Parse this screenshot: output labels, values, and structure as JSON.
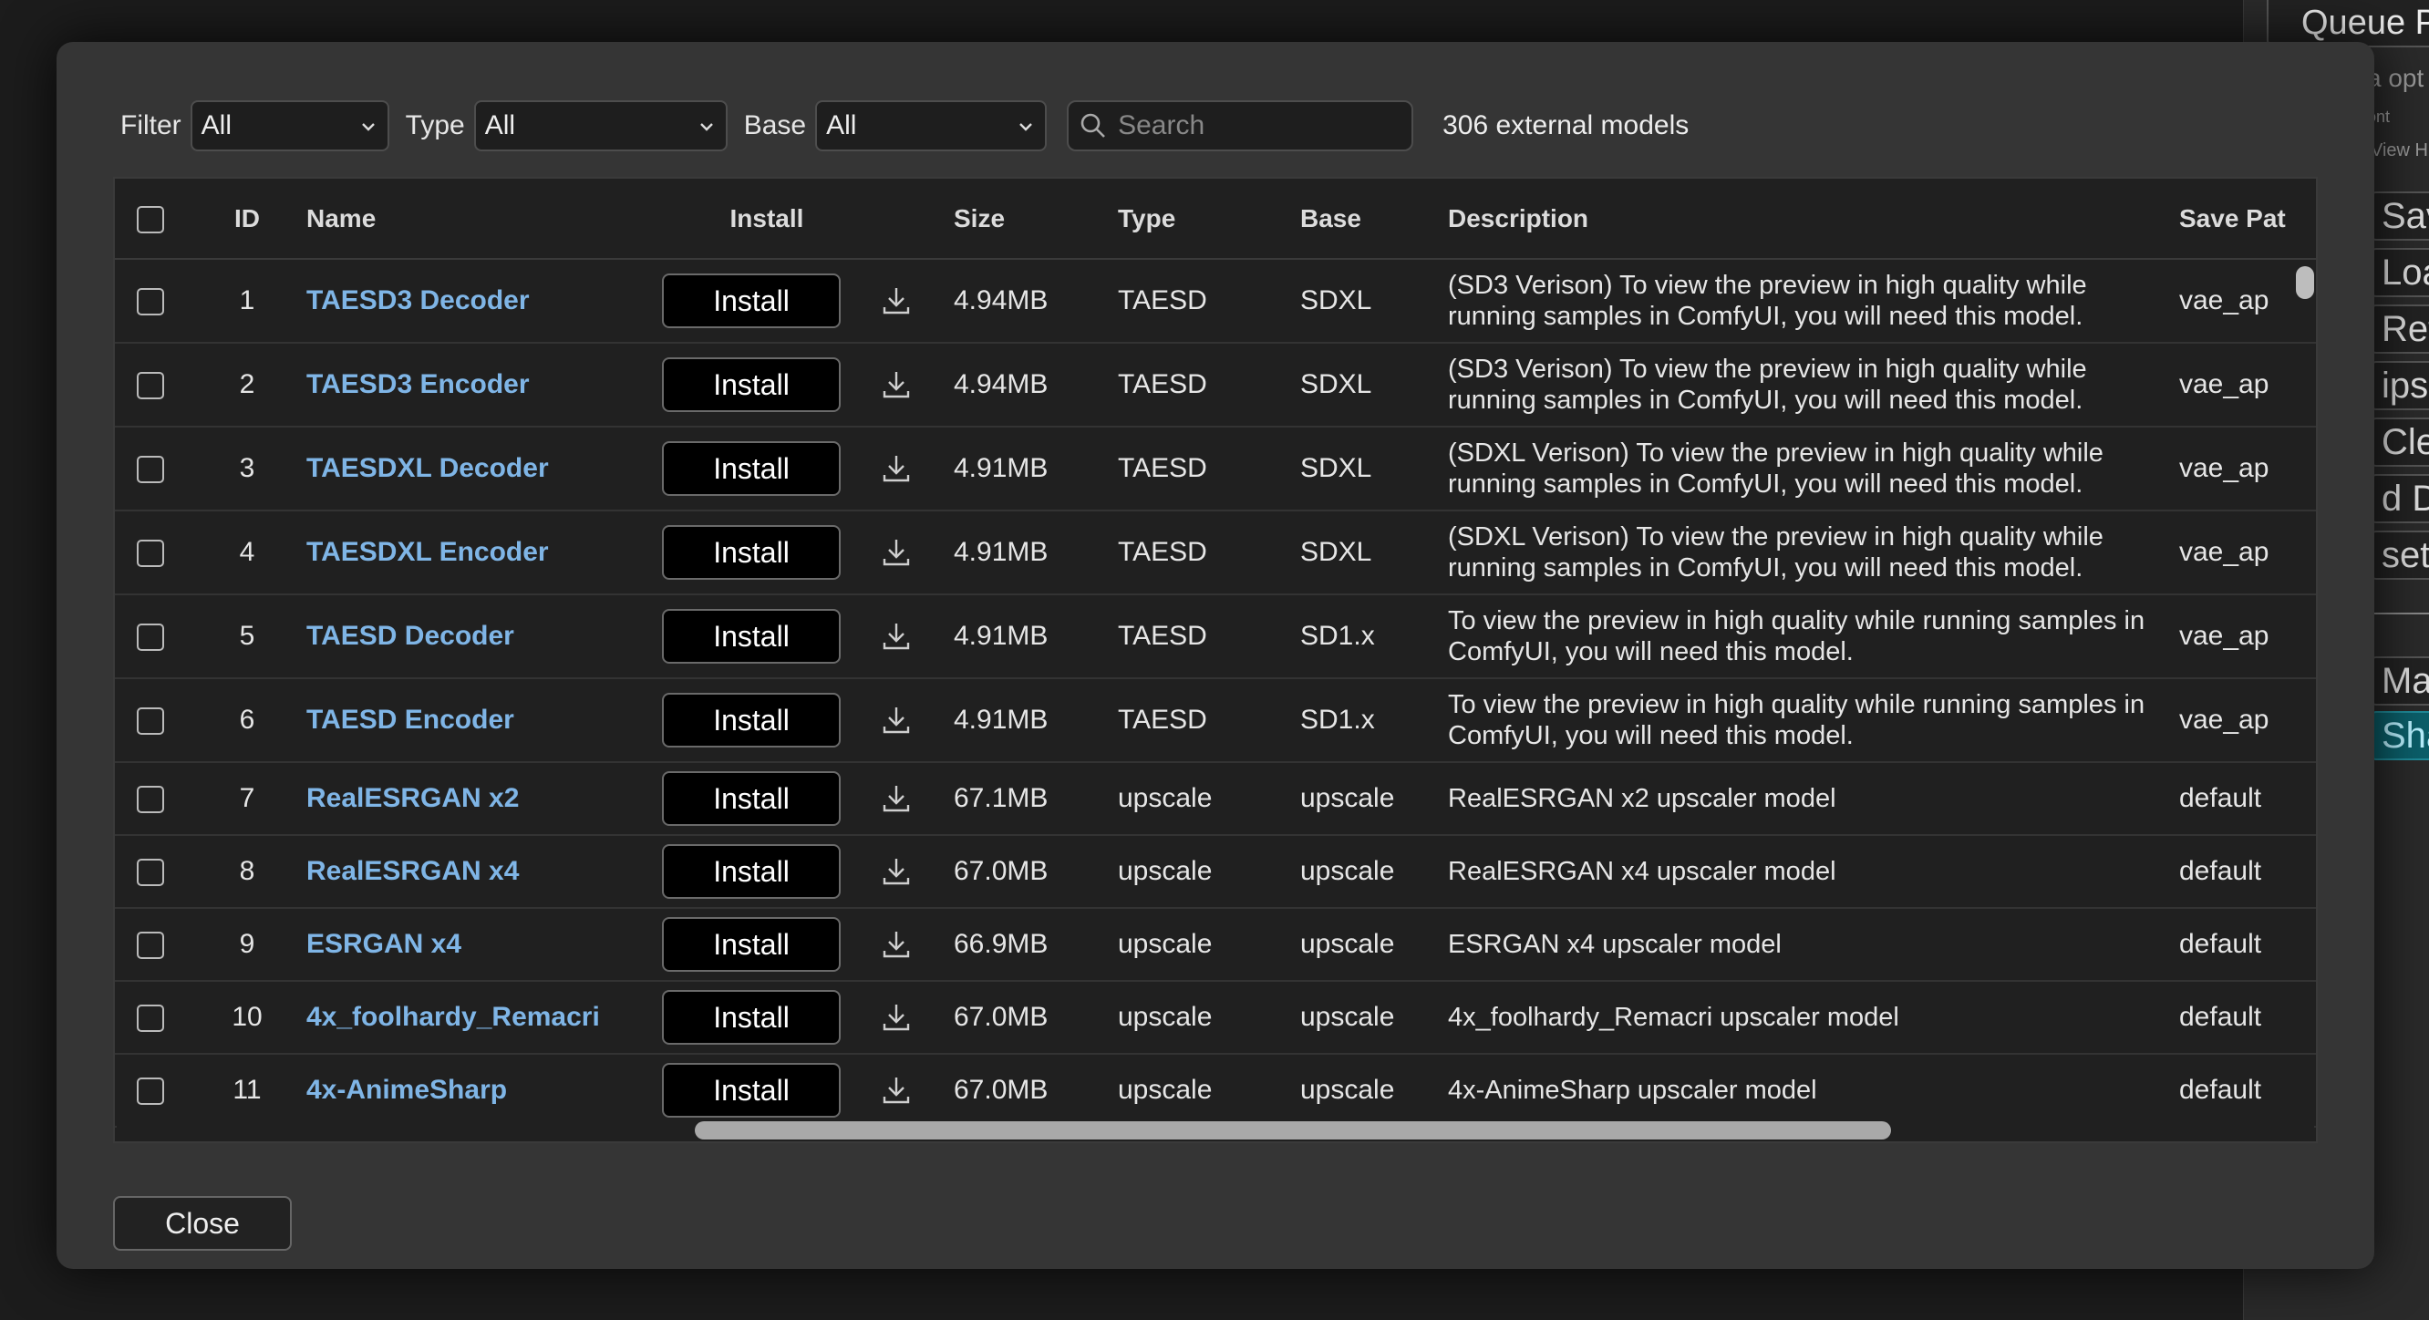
{
  "background": {
    "queue_label": "Queue P",
    "options_text": "a opt",
    "small_text": "ont",
    "view_history": "View Hi",
    "buttons": [
      "Sav",
      "Loa",
      "Refr",
      "ipsp",
      "Cle",
      "d D",
      "set",
      "Mana",
      "Sha"
    ]
  },
  "filters": {
    "filter_label": "Filter",
    "filter_value": "All",
    "type_label": "Type",
    "type_value": "All",
    "base_label": "Base",
    "base_value": "All",
    "search_placeholder": "Search",
    "count_text": "306 external models"
  },
  "table": {
    "headers": {
      "id": "ID",
      "name": "Name",
      "install": "Install",
      "size": "Size",
      "type": "Type",
      "base": "Base",
      "description": "Description",
      "save_path": "Save Pat"
    },
    "rows": [
      {
        "id": "1",
        "name": "TAESD3 Decoder",
        "install": "Install",
        "size": "4.94MB",
        "type": "TAESD",
        "base": "SDXL",
        "description": "(SD3 Verison) To view the preview in high quality while running samples in ComfyUI, you will need this model.",
        "save_path": "vae_ap"
      },
      {
        "id": "2",
        "name": "TAESD3 Encoder",
        "install": "Install",
        "size": "4.94MB",
        "type": "TAESD",
        "base": "SDXL",
        "description": "(SD3 Verison) To view the preview in high quality while running samples in ComfyUI, you will need this model.",
        "save_path": "vae_ap"
      },
      {
        "id": "3",
        "name": "TAESDXL Decoder",
        "install": "Install",
        "size": "4.91MB",
        "type": "TAESD",
        "base": "SDXL",
        "description": "(SDXL Verison) To view the preview in high quality while running samples in ComfyUI, you will need this model.",
        "save_path": "vae_ap"
      },
      {
        "id": "4",
        "name": "TAESDXL Encoder",
        "install": "Install",
        "size": "4.91MB",
        "type": "TAESD",
        "base": "SDXL",
        "description": "(SDXL Verison) To view the preview in high quality while running samples in ComfyUI, you will need this model.",
        "save_path": "vae_ap"
      },
      {
        "id": "5",
        "name": "TAESD Decoder",
        "install": "Install",
        "size": "4.91MB",
        "type": "TAESD",
        "base": "SD1.x",
        "description": "To view the preview in high quality while running samples in ComfyUI, you will need this model.",
        "save_path": "vae_ap"
      },
      {
        "id": "6",
        "name": "TAESD Encoder",
        "install": "Install",
        "size": "4.91MB",
        "type": "TAESD",
        "base": "SD1.x",
        "description": "To view the preview in high quality while running samples in ComfyUI, you will need this model.",
        "save_path": "vae_ap"
      },
      {
        "id": "7",
        "name": "RealESRGAN x2",
        "install": "Install",
        "size": "67.1MB",
        "type": "upscale",
        "base": "upscale",
        "description": "RealESRGAN x2 upscaler model",
        "save_path": "default"
      },
      {
        "id": "8",
        "name": "RealESRGAN x4",
        "install": "Install",
        "size": "67.0MB",
        "type": "upscale",
        "base": "upscale",
        "description": "RealESRGAN x4 upscaler model",
        "save_path": "default"
      },
      {
        "id": "9",
        "name": "ESRGAN x4",
        "install": "Install",
        "size": "66.9MB",
        "type": "upscale",
        "base": "upscale",
        "description": "ESRGAN x4 upscaler model",
        "save_path": "default"
      },
      {
        "id": "10",
        "name": "4x_foolhardy_Remacri",
        "install": "Install",
        "size": "67.0MB",
        "type": "upscale",
        "base": "upscale",
        "description": "4x_foolhardy_Remacri upscaler model",
        "save_path": "default"
      },
      {
        "id": "11",
        "name": "4x-AnimeSharp",
        "install": "Install",
        "size": "67.0MB",
        "type": "upscale",
        "base": "upscale",
        "description": "4x-AnimeSharp upscaler model",
        "save_path": "default"
      }
    ]
  },
  "close_label": "Close",
  "colors": {
    "link": "#7fb5e6",
    "modal_bg": "#353535",
    "table_bg": "#202020",
    "accent_button": "#0b5f6a"
  }
}
